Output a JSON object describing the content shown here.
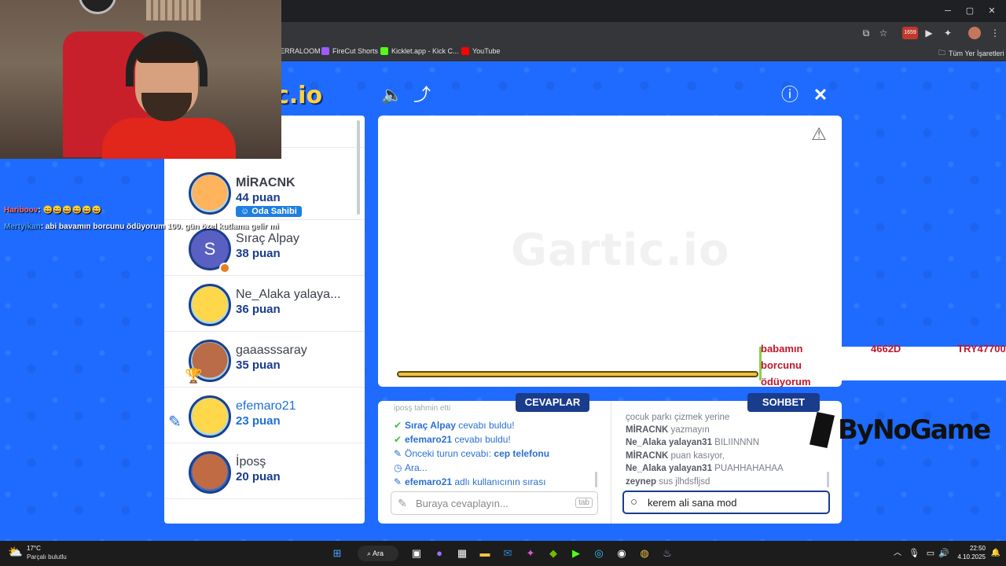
{
  "browser": {
    "bookmarks": [
      {
        "label": "ERRALOOM",
        "color": "#35363a"
      },
      {
        "label": "FireCut Shorts",
        "color": "#9c5cff"
      },
      {
        "label": "Kicklet.app - Kick C...",
        "color": "#53fc18"
      },
      {
        "label": "YouTube",
        "color": "#ff0000"
      }
    ],
    "all_bookmarks": "Tüm Yer İşaretleri",
    "counter_badge": "1659"
  },
  "stream_overlay": {
    "chat": [
      {
        "user": "Hariboov",
        "text": ": 😄😄😄😄😄😄",
        "user_color": "#ff6b6b"
      },
      {
        "user": "Mertyikan",
        "text": ": abi bavamın borcunu ödüyorum 100. gün özel kutlama gelir mi",
        "user_color": "#4aa3ff"
      }
    ],
    "ticker": [
      "babamın",
      "borcunu",
      "ödüyorum"
    ],
    "ticker_right": [
      "4662D",
      "TRY47700"
    ]
  },
  "game": {
    "logo": "c.io",
    "watermark": "Gartic.io",
    "players": [
      {
        "name": "MİRACNK",
        "points": "44 puan",
        "owner": "Oda Sahibi",
        "face": "face-o",
        "bold_name": true
      },
      {
        "name": "Sıraç Alpay",
        "points": "38 puan",
        "initial": "S",
        "face": "face-s"
      },
      {
        "name": "Ne_Alaka yalaya...",
        "points": "36 puan",
        "face": "face-y"
      },
      {
        "name": "gaaasssaray",
        "points": "35 puan",
        "face": "face-b",
        "trophy": "1"
      },
      {
        "name": "efemaro21",
        "points": "23 puan",
        "face": "face-y",
        "drawing": true
      },
      {
        "name": "İposş",
        "points": "20 puan",
        "face": "face-t"
      }
    ],
    "tabs": {
      "answers": "CEVAPLAR",
      "chat": "SOHBET"
    },
    "answers": [
      {
        "icon": "check",
        "user": "Sıraç Alpay",
        "text": " cevabı buldu!"
      },
      {
        "icon": "check",
        "user": "efemaro21",
        "text": " cevabı buldu!"
      },
      {
        "icon": "pencil",
        "user": "",
        "text": "Önceki turun cevabı: ",
        "bold_tail": "cep telefonu"
      },
      {
        "icon": "clock",
        "user": "",
        "text": "Ara..."
      },
      {
        "icon": "pencil",
        "user": "efemaro21",
        "text": " adlı kullanıcının sırası"
      }
    ],
    "answers_partial": "iposş tahmin etti",
    "answer_placeholder": "Buraya cevaplayın...",
    "answer_hint": "tab",
    "chat": [
      {
        "user": "",
        "text": "çocuk parkı çizmek yerine"
      },
      {
        "user": "MİRACNK",
        "text": " yazmayın"
      },
      {
        "user": "Ne_Alaka yalayan31",
        "text": " BILIINNNN"
      },
      {
        "user": "MİRACNK",
        "text": " puan kasıyor,"
      },
      {
        "user": "Ne_Alaka yalayan31",
        "text": " PUAHHAHAHAA"
      },
      {
        "user": "zeynep",
        "text": " sus jlhdsfljsd"
      }
    ],
    "chat_input": "kerem ali sana mod"
  },
  "sponsor": "ByNoGame",
  "taskbar": {
    "weather_temp": "17°C",
    "weather_desc": "Parçalı bulutlu",
    "search": "Ara",
    "time": "22:50",
    "date": "4.10.2025"
  }
}
